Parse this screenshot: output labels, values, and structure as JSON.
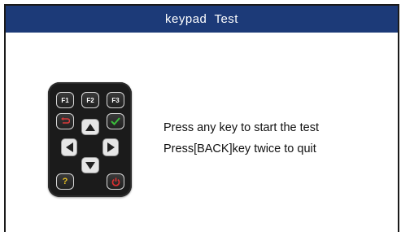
{
  "window": {
    "title": "keypad  Test"
  },
  "keypad": {
    "keys": {
      "f1": "F1",
      "f2": "F2",
      "f3": "F3",
      "help": "?"
    },
    "icons": {
      "back": "back-arrow-icon",
      "ok": "checkmark-icon",
      "up": "arrow-up-icon",
      "down": "arrow-down-icon",
      "left": "arrow-left-icon",
      "right": "arrow-right-icon",
      "power": "power-icon"
    },
    "colors": {
      "back": "#d83a3a",
      "ok": "#3bbd3b",
      "help": "#e8c020",
      "power": "#e03030",
      "title_bar": "#1c3a78"
    }
  },
  "instructions": {
    "line1": "Press any key to start the test",
    "line2": "Press[BACK]key twice to quit"
  }
}
